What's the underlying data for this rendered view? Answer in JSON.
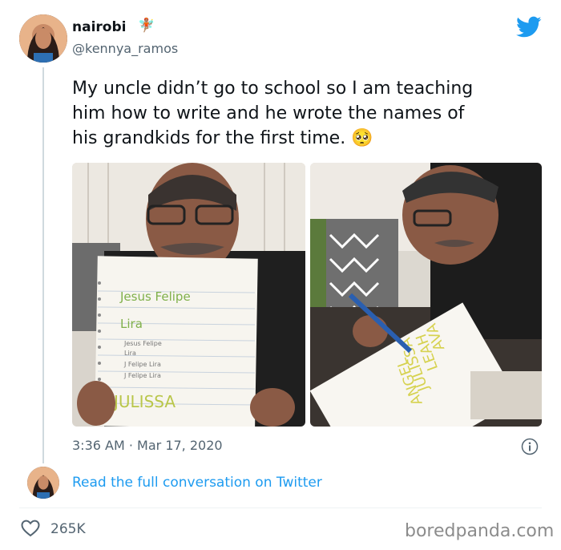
{
  "author": {
    "name": "nairobi",
    "handle": "@kennya_ramos",
    "badge_emoji": "🧚🏽"
  },
  "logo_icon": "twitter-bird-icon",
  "tweet": {
    "lines": [
      "My uncle didn’t go to school so I am teaching",
      "him how to write and he wrote the names of",
      "his grandkids for the first time."
    ],
    "emoji": "🥺"
  },
  "photo_left": {
    "notebook_lines": [
      "Jesus Felipe",
      "Lira",
      "Jesus   Felipe",
      "Lira",
      "J Felipe Lira",
      "J Felipe Lira",
      "JULISSA"
    ]
  },
  "photo_right": {
    "notebook_lines": [
      "JULISSA",
      "LEAH",
      "AVA",
      "ANGEL"
    ]
  },
  "timestamp": {
    "time": "3:36 AM",
    "separator": "·",
    "date": "Mar 17, 2020"
  },
  "read_more": "Read the full conversation on Twitter",
  "likes": "265K",
  "watermark": "boredpanda.com",
  "colors": {
    "accent": "#1d9bf0",
    "like_icon": "#536471"
  }
}
